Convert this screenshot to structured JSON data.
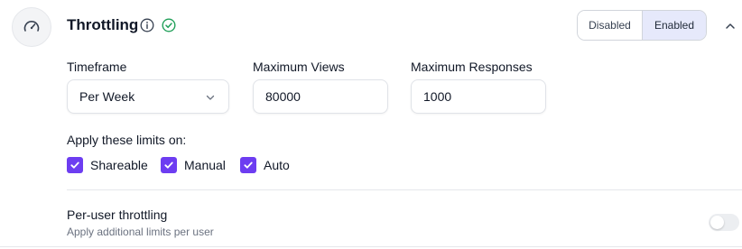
{
  "header": {
    "title": "Throttling",
    "status_color": "#22a05a",
    "toggle": {
      "disabled_label": "Disabled",
      "enabled_label": "Enabled",
      "selected": "Enabled"
    }
  },
  "fields": {
    "timeframe": {
      "label": "Timeframe",
      "value": "Per Week"
    },
    "max_views": {
      "label": "Maximum Views",
      "value": "80000"
    },
    "max_responses": {
      "label": "Maximum Responses",
      "value": "1000"
    }
  },
  "apply": {
    "label": "Apply these limits on:",
    "options": [
      {
        "label": "Shareable",
        "checked": true
      },
      {
        "label": "Manual",
        "checked": true
      },
      {
        "label": "Auto",
        "checked": true
      }
    ],
    "accent_color": "#6d3df1"
  },
  "per_user": {
    "title": "Per-user throttling",
    "description": "Apply additional limits per user",
    "enabled": false
  }
}
